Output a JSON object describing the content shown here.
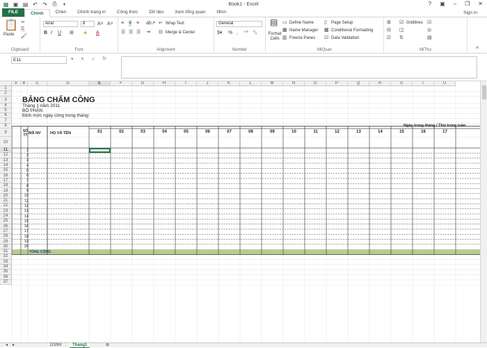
{
  "title": "Book1 - Excel",
  "signin": "Sign in",
  "tabs": [
    {
      "label": "FILE"
    },
    {
      "label": "Chính"
    },
    {
      "label": "Chèn"
    },
    {
      "label": "Chính trang in"
    },
    {
      "label": "Công thức"
    },
    {
      "label": "Dữ liệu"
    },
    {
      "label": "Xem tổng quan"
    },
    {
      "label": "Nhìn"
    }
  ],
  "ribbon": {
    "clipboard": {
      "paste": "Paste",
      "label": "Clipboard"
    },
    "font": {
      "name": "Arial",
      "size": "8",
      "label": "Font"
    },
    "alignment": {
      "wrap": "Wrap Text",
      "merge": "Merge & Center",
      "label": "Alignment"
    },
    "number": {
      "format": "General",
      "label": "Number"
    },
    "quan": {
      "format_cells": "Format Cells",
      "define_name": "Define Name",
      "name_manager": "Name Manager",
      "freeze": "Freeze Panes",
      "page_setup": "Page Setup",
      "cond": "Conditional Formatting",
      "validation": "Data Validation",
      "label": "MiQuan"
    },
    "mithu": {
      "gridlines": "Gridlines",
      "label": "MiThu"
    }
  },
  "formula": {
    "cell": "E11",
    "fx": "fx",
    "value": ""
  },
  "columns": [
    "A",
    "B",
    "C",
    "D",
    "E",
    "F",
    "G",
    "H",
    "I",
    "J",
    "K",
    "L",
    "M",
    "N",
    "O",
    "P",
    "Q",
    "R",
    "S",
    "T",
    "U"
  ],
  "rows": [
    "1",
    "2",
    "3",
    "4",
    "5",
    "6",
    "7",
    "8",
    "9",
    "10",
    "11",
    "12",
    "13",
    "14",
    "15",
    "16",
    "17",
    "18",
    "19",
    "20",
    "21",
    "22",
    "23",
    "24",
    "25",
    "26",
    "27",
    "28",
    "29",
    "30",
    "31",
    "32",
    "33",
    "34",
    "35",
    "36",
    "37"
  ],
  "sheet": {
    "title": "BẢNG CHẤM CÔNG",
    "month": "Tháng 1 năm 2011",
    "dept": "BỘ PHẬN",
    "norm": "Định mức ngày công trong tháng:",
    "header_right": "Ngày trong tháng / Thứ trong tuần",
    "col_stt": "SỐ TT",
    "col_ma": "MÃ NV",
    "col_ten": "HỌ VÀ TÊN",
    "days": [
      "01",
      "02",
      "03",
      "04",
      "05",
      "06",
      "07",
      "08",
      "09",
      "10",
      "11",
      "12",
      "13",
      "14",
      "15",
      "16",
      "17"
    ],
    "stt": [
      "1",
      "2",
      "3",
      "4",
      "5",
      "6",
      "7",
      "8",
      "9",
      "10",
      "11",
      "12",
      "13",
      "14",
      "15",
      "16",
      "17",
      "18",
      "19",
      "20"
    ],
    "total": "TỔNG CỘNG",
    "total_color": "#b7cc8f"
  },
  "sheet_tabs": [
    {
      "label": "DSNV"
    },
    {
      "label": "Thang1"
    }
  ],
  "accent": "#217346"
}
